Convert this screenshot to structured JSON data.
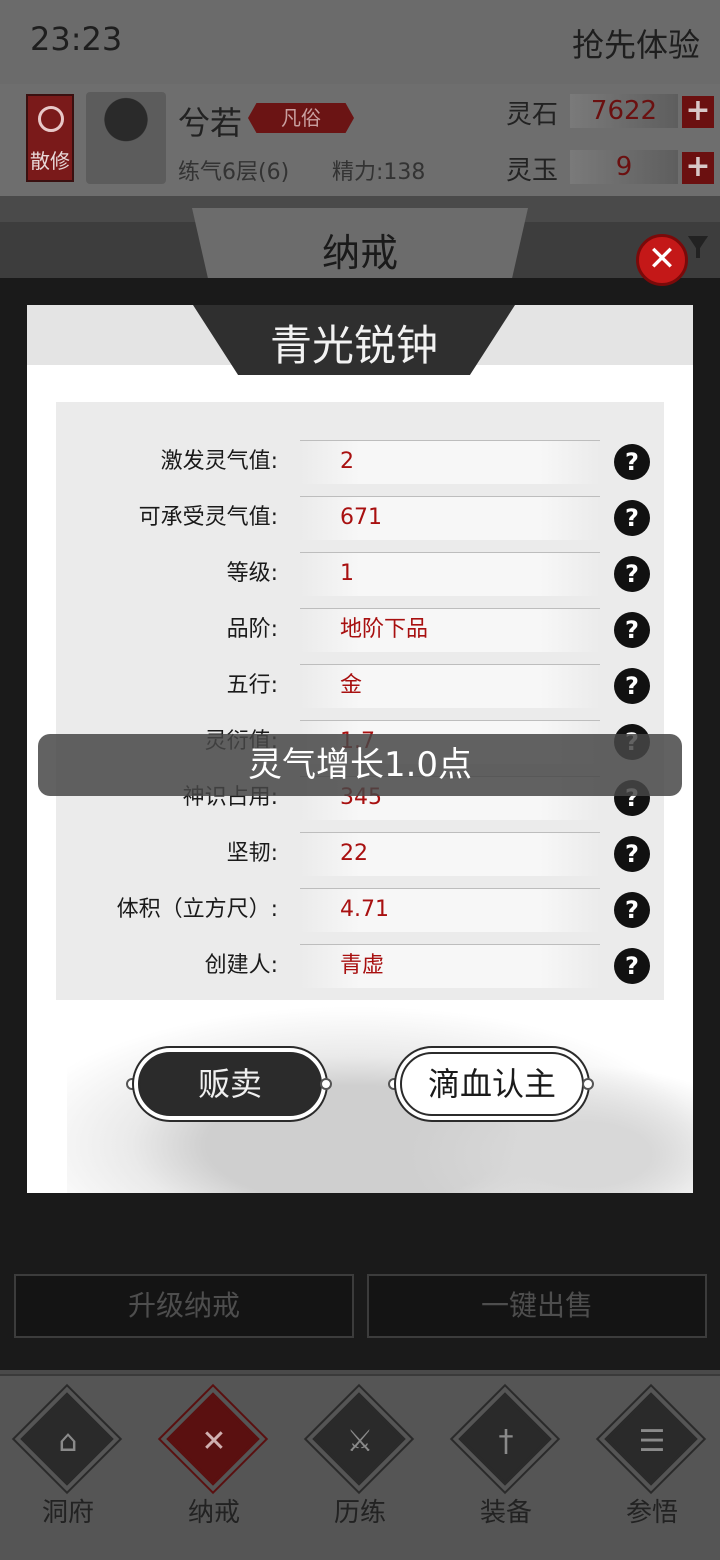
{
  "status_bar": {
    "time": "23:23",
    "trial_label": "抢先体验"
  },
  "profile": {
    "sect_badge": "散修",
    "name": "兮若",
    "rank": "凡俗",
    "level": "练气6层(6)",
    "energy": "精力:138",
    "currencies": [
      {
        "label": "灵石",
        "value": "7622"
      },
      {
        "label": "灵玉",
        "value": "9"
      }
    ]
  },
  "page": {
    "title": "纳戒"
  },
  "modal": {
    "title": "青光锐钟",
    "attributes": [
      {
        "label": "激发灵气值:",
        "value": "2"
      },
      {
        "label": "可承受灵气值:",
        "value": "671"
      },
      {
        "label": "等级:",
        "value": "1"
      },
      {
        "label": "品阶:",
        "value": "地阶下品"
      },
      {
        "label": "五行:",
        "value": "金"
      },
      {
        "label": "灵衍值:",
        "value": "1.7"
      },
      {
        "label": "神识占用:",
        "value": "345"
      },
      {
        "label": "坚韧:",
        "value": "22"
      },
      {
        "label": "体积（立方尺）:",
        "value": "4.71"
      },
      {
        "label": "创建人:",
        "value": "青虚"
      }
    ],
    "sell_label": "贩卖",
    "bind_label": "滴血认主"
  },
  "toast": "灵气增长1.0点",
  "bottom_buttons": {
    "upgrade": "升级纳戒",
    "sell_all": "一键出售"
  },
  "nav": [
    {
      "label": "洞府",
      "icon": "pavilion-icon"
    },
    {
      "label": "纳戒",
      "icon": "ring-icon"
    },
    {
      "label": "历练",
      "icon": "crossed-swords-icon"
    },
    {
      "label": "装备",
      "icon": "dagger-icon"
    },
    {
      "label": "参悟",
      "icon": "book-icon"
    }
  ],
  "colors": {
    "accent_red": "#a81010",
    "close_red": "#c41818",
    "dark": "#2b2b2b"
  }
}
